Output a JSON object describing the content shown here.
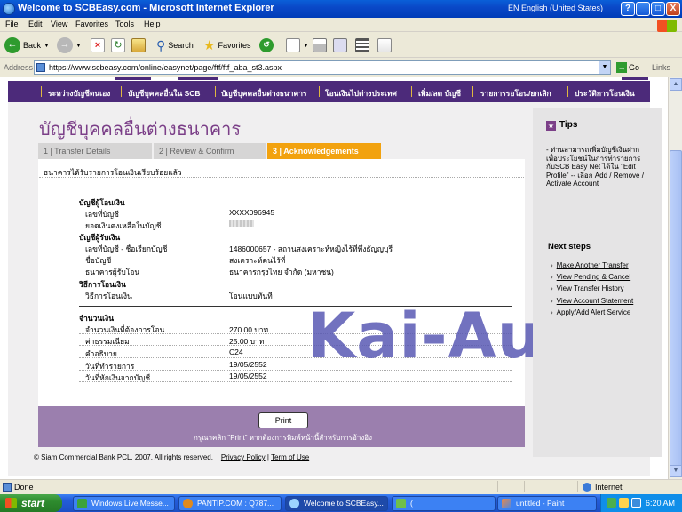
{
  "window": {
    "title": "Welcome to SCBEasy.com - Microsoft Internet Explorer",
    "language": "EN English (United States)",
    "controls": {
      "help": "?",
      "minimize": "_",
      "maximize": "□",
      "close": "X"
    }
  },
  "menubar": {
    "items": [
      "File",
      "Edit",
      "View",
      "Favorites",
      "Tools",
      "Help"
    ]
  },
  "toolbar": {
    "back_label": "Back",
    "search_label": "Search",
    "favorites_label": "Favorites"
  },
  "addressbar": {
    "label": "Address",
    "url": "https://www.scbeasy.com/online/easynet/page/ftf/ftf_aba_st3.aspx",
    "go_label": "Go",
    "links_label": "Links"
  },
  "nav": {
    "items": [
      "ระหว่างบัญชีตนเอง",
      "บัญชีบุคคลอื่นใน SCB",
      "บัญชีบุคคลอื่นต่างธนาคาร",
      "โอนเงินไปต่างประเทศ",
      "เพิ่ม/ลด บัญชี",
      "รายการรอโอน/ยกเลิก",
      "ประวัติการโอนเงิน"
    ]
  },
  "page": {
    "title": "บัญชีบุคคลอื่นต่างธนาคาร",
    "steps": [
      "1 | Transfer Details",
      "2 | Review & Confirm",
      "3 | Acknowledgements"
    ],
    "success_message": "ธนาคารได้รับรายการโอนเงินเรียบร้อยแล้ว"
  },
  "from_account": {
    "heading": "บัญชีผู้โอนเงิน",
    "account_no_label": "เลขที่บัญชี",
    "account_no": "XXXX096945",
    "balance_label": "ยอดเงินคงเหลือในบัญชี"
  },
  "to_account": {
    "heading": "บัญชีผู้รับเงิน",
    "account_label": "เลขที่บัญชี - ชื่อเรียกบัญชี",
    "account_value": "1486000657 - สถานสงเคราะห์หญิงไร้ที่พึ่งธัญญบุรี",
    "name_label": "ชื่อบัญชี",
    "name_value": "สงเคราะห์คนไร้ที่",
    "bank_label": "ธนาคารผู้รับโอน",
    "bank_value": "ธนาคารกรุงไทย จำกัด (มหาชน)"
  },
  "method": {
    "heading": "วิธีการโอนเงิน",
    "label": "วิธีการโอนเงิน",
    "value": "โอนแบบทันที"
  },
  "amount": {
    "heading": "จำนวนเงิน",
    "rows": [
      {
        "label": "จำนวนเงินที่ต้องการโอน",
        "value": "270.00 บาท"
      },
      {
        "label": "ค่าธรรมเนียม",
        "value": "25.00 บาท"
      },
      {
        "label": "คำอธิบาย",
        "value": "C24"
      },
      {
        "label": "วันที่ทำรายการ",
        "value": "19/05/2552"
      },
      {
        "label": "วันที่หักเงินจากบัญชี",
        "value": "19/05/2552"
      }
    ]
  },
  "watermark": "Kai-Au",
  "print": {
    "button_label": "Print",
    "hint": "กรุณาคลิก \"Print\" หากต้องการพิมพ์หน้านี้สำหรับการอ้างอิง"
  },
  "footer": {
    "copyright": "© Siam Commercial Bank PCL. 2007. All rights reserved.",
    "privacy": "Privacy Policy",
    "separator": "|",
    "terms": "Term of Use"
  },
  "tips": {
    "title": "Tips",
    "text": "- ท่านสามารถเพิ่มบัญชีเงินฝาก เพื่อประโยชน์ในการทำรายการ กับSCB Easy Net ได้ใน \"Edit Profile\" -- เลือก Add / Remove / Activate Account",
    "next_steps_title": "Next steps",
    "links": [
      "Make Another Transfer",
      "View Pending & Cancel",
      "View Transfer History",
      "View Account Statement",
      "Apply/Add Alert Service"
    ]
  },
  "statusbar": {
    "status": "Done",
    "zone": "Internet"
  },
  "taskbar": {
    "start": "start",
    "tasks": [
      "Windows Live Messe...",
      "PANTIP.COM : Q787...",
      "Welcome to SCBEasy...",
      "(",
      "untitled - Paint"
    ],
    "clock": "6:20 AM"
  }
}
